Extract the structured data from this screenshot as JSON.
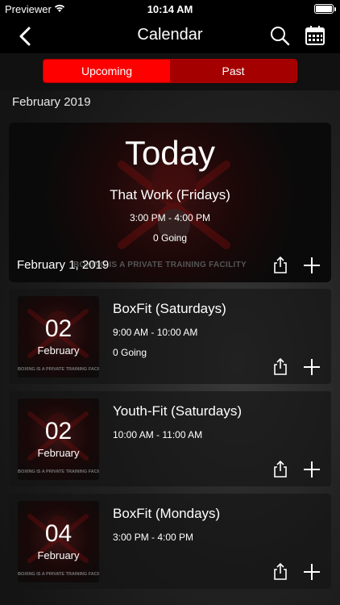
{
  "status_bar": {
    "carrier": "Previewer",
    "time": "10:14 AM"
  },
  "nav": {
    "title": "Calendar"
  },
  "tabs": [
    {
      "label": "Upcoming"
    },
    {
      "label": "Past"
    }
  ],
  "section": {
    "month": "February 2019"
  },
  "today": {
    "heading": "Today",
    "event_name": "That Work (Fridays)",
    "time": "3:00 PM - 4:00 PM",
    "going": "0 Going",
    "date": "February 1, 2019",
    "banner": "BOXING IS A PRIVATE TRAINING FACILITY"
  },
  "events": [
    {
      "day": "02",
      "month": "February",
      "name": "BoxFit (Saturdays)",
      "time": "9:00 AM - 10:00 AM",
      "going": "0 Going"
    },
    {
      "day": "02",
      "month": "February",
      "name": "Youth-Fit (Saturdays)",
      "time": "10:00 AM - 11:00 AM",
      "going": ""
    },
    {
      "day": "04",
      "month": "February",
      "name": "BoxFit (Mondays)",
      "time": "3:00 PM - 4:00 PM",
      "going": ""
    }
  ],
  "thumb_banner": "BOXING IS A PRIVATE TRAINING FACILITY",
  "colors": {
    "accent": "#ff0000",
    "accent_dark": "#a50000",
    "nav_bg": "#000000"
  },
  "icons": [
    "back-chevron-icon",
    "search-icon",
    "calendar-icon",
    "share-icon",
    "add-icon"
  ]
}
